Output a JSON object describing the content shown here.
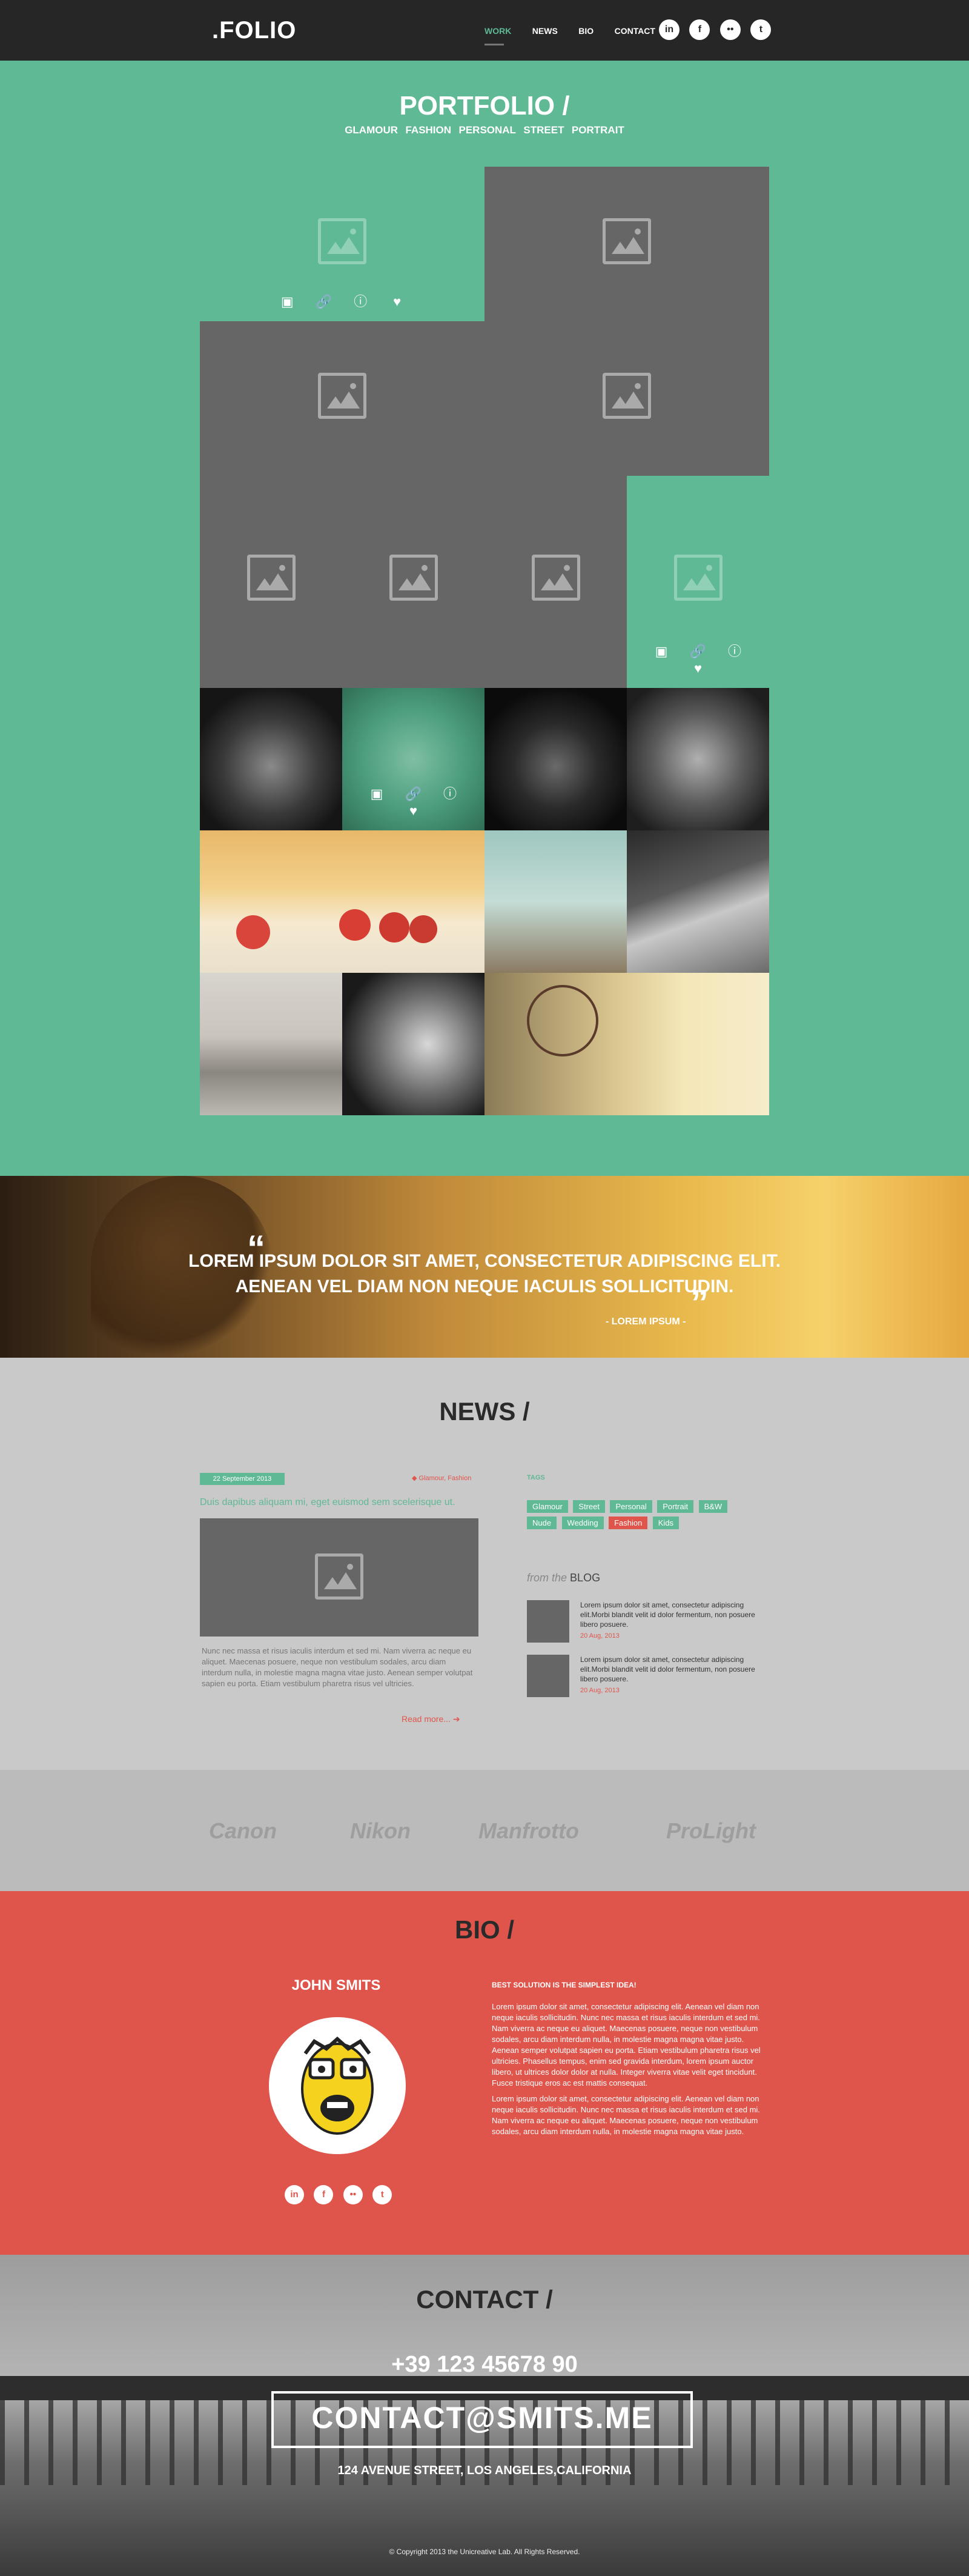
{
  "header": {
    "logo": ".FOLIO",
    "nav": [
      "WORK",
      "NEWS",
      "BIO",
      "CONTACT"
    ],
    "social": [
      "in",
      "f",
      "••",
      "t"
    ],
    "accent": "#5fb995"
  },
  "portfolio": {
    "title": "PORTFOLIO /",
    "filters": [
      "GLAMOUR",
      "FASHION",
      "PERSONAL",
      "STREET",
      "PORTRAIT"
    ],
    "tile_icons": [
      "gallery-icon",
      "link-icon",
      "info-icon",
      "heart-icon"
    ],
    "bg_color": "#5fb995"
  },
  "quote": {
    "line1": "LOREM IPSUM DOLOR SIT AMET, CONSECTETUR ADIPISCING ELIT.",
    "line2": "AENEAN VEL DIAM NON NEQUE IACULIS SOLLICITUDIN.",
    "author": "- LOREM IPSUM -"
  },
  "news": {
    "title": "NEWS /",
    "post": {
      "date": "22 September 2013",
      "tags": "Glamour, Fashion",
      "title": "Duis dapibus aliquam mi, eget euismod sem scelerisque ut.",
      "excerpt": "Nunc nec massa et risus iaculis interdum et sed mi. Nam viverra ac neque eu aliquet. Maecenas posuere, neque non vestibulum sodales, arcu diam interdum nulla, in molestie magna magna vitae justo. Aenean semper volutpat sapien eu porta. Etiam vestibulum pharetra risus vel ultricies.",
      "read_more": "Read more..."
    },
    "tags_label": "TAGS",
    "tags": [
      "Glamour",
      "Street",
      "Personal",
      "Portrait",
      "B&W",
      "Nude",
      "Wedding",
      "Fashion",
      "Kids"
    ],
    "active_tag": "Fashion",
    "blog_label_prefix": "from the",
    "blog_label": "BLOG",
    "blog_items": [
      {
        "text": "Lorem ipsum dolor sit amet, consectetur adipiscing elit.Morbi blandit velit id dolor fermentum, non posuere libero posuere.",
        "date": "20 Aug, 2013"
      },
      {
        "text": "Lorem ipsum dolor sit amet, consectetur adipiscing elit.Morbi blandit velit id dolor fermentum, non posuere libero posuere.",
        "date": "20 Aug, 2013"
      }
    ]
  },
  "brands": [
    "Canon",
    "Nikon",
    "Manfrotto",
    "ProLight"
  ],
  "bio": {
    "title": "BIO /",
    "name": "JOHN SMITS",
    "heading": "BEST SOLUTION IS THE SIMPLEST IDEA!",
    "para1": "Lorem ipsum dolor sit amet, consectetur adipiscing elit. Aenean vel diam non neque iaculis sollicitudin. Nunc nec massa et risus iaculis interdum et sed mi. Nam viverra ac neque eu aliquet. Maecenas posuere, neque non vestibulum sodales, arcu diam interdum nulla, in molestie magna magna vitae justo. Aenean semper volutpat sapien eu porta. Etiam vestibulum pharetra risus vel ultricies. Phasellus tempus, enim sed gravida interdum, lorem ipsum auctor libero, ut ultrices dolor dolor at nulla. Integer viverra vitae velit eget tincidunt. Fusce tristique eros ac est mattis consequat.",
    "para2": "Lorem ipsum dolor sit amet, consectetur adipiscing elit. Aenean vel diam non neque iaculis sollicitudin. Nunc nec massa et risus iaculis interdum et sed mi. Nam viverra ac neque eu aliquet. Maecenas posuere, neque non vestibulum sodales, arcu diam interdum nulla, in molestie magna magna vitae justo.",
    "social": [
      "in",
      "f",
      "••",
      "t"
    ],
    "bg_color": "#e0554b"
  },
  "contact": {
    "title": "CONTACT /",
    "phone": "+39 123 45678 90",
    "email": "CONTACT@SMITS.ME",
    "address": "124 AVENUE STREET, LOS ANGELES,CALIFORNIA",
    "copyright": "© Copyright 2013 the Unicreative Lab. All Rights Reserved."
  }
}
